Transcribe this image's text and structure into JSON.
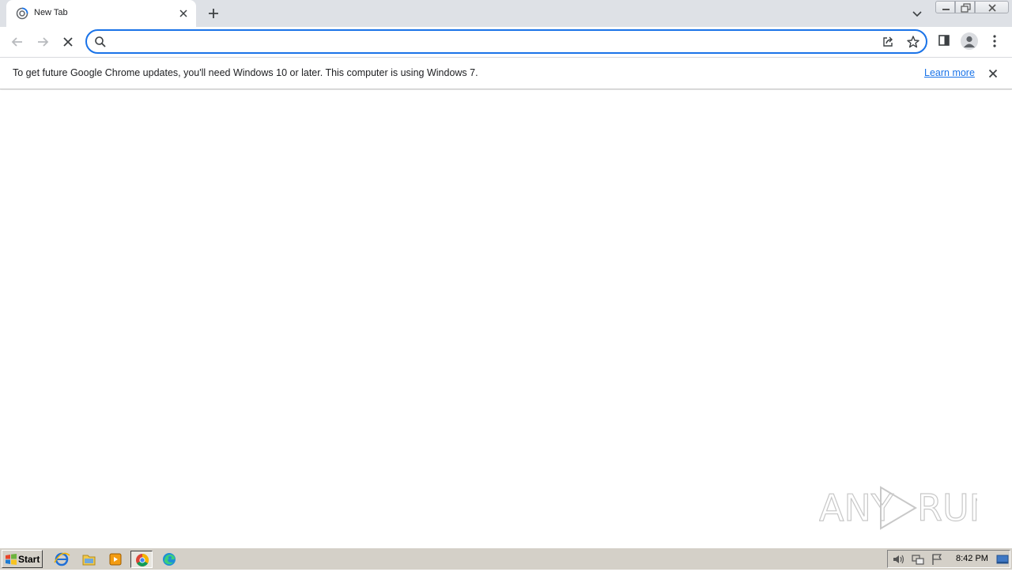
{
  "tab": {
    "title": "New Tab"
  },
  "omnibox": {
    "value": "",
    "placeholder": ""
  },
  "infobar": {
    "message": "To get future Google Chrome updates, you'll need Windows 10 or later. This computer is using Windows 7.",
    "link_label": "Learn more"
  },
  "watermark": {
    "text": "ANY RUN"
  },
  "taskbar": {
    "start_label": "Start",
    "apps": [
      "internet-explorer-icon",
      "file-explorer-icon",
      "media-player-icon",
      "chrome-icon",
      "edge-icon"
    ],
    "clock": "8:42 PM"
  },
  "colors": {
    "accent": "#1a73e8",
    "tabstrip": "#dee1e6",
    "taskbar": "#d4d0c8"
  }
}
